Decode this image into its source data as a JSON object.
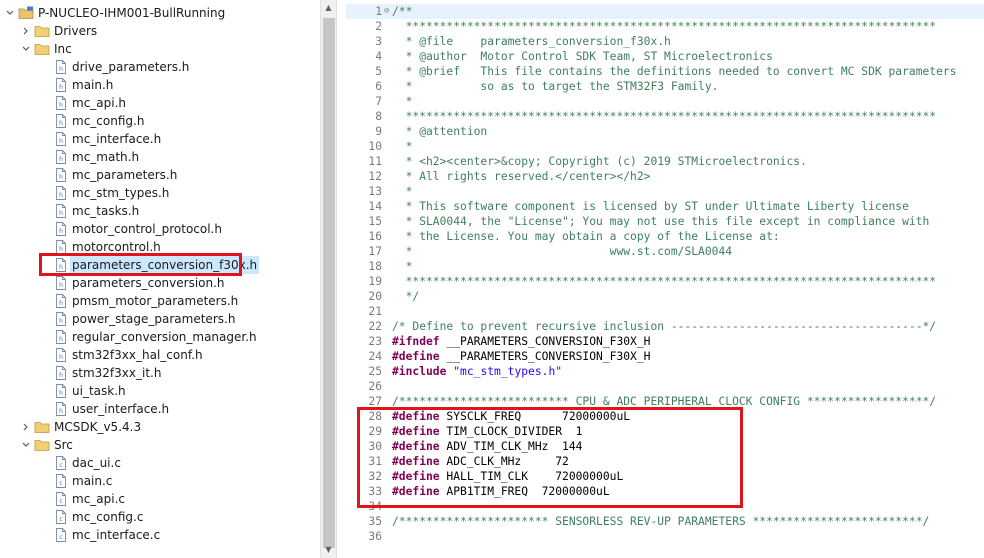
{
  "explorer": {
    "project": "P-NUCLEO-IHM001-BullRunning",
    "items": [
      {
        "label": "Drivers",
        "type": "folder",
        "expanded": false,
        "level": 1
      },
      {
        "label": "Inc",
        "type": "folder",
        "expanded": true,
        "level": 1
      },
      {
        "label": "drive_parameters.h",
        "type": "file",
        "level": 2
      },
      {
        "label": "main.h",
        "type": "file",
        "level": 2
      },
      {
        "label": "mc_api.h",
        "type": "file",
        "level": 2
      },
      {
        "label": "mc_config.h",
        "type": "file",
        "level": 2
      },
      {
        "label": "mc_interface.h",
        "type": "file",
        "level": 2
      },
      {
        "label": "mc_math.h",
        "type": "file",
        "level": 2
      },
      {
        "label": "mc_parameters.h",
        "type": "file",
        "level": 2
      },
      {
        "label": "mc_stm_types.h",
        "type": "file",
        "level": 2
      },
      {
        "label": "mc_tasks.h",
        "type": "file",
        "level": 2
      },
      {
        "label": "motor_control_protocol.h",
        "type": "file",
        "level": 2
      },
      {
        "label": "motorcontrol.h",
        "type": "file",
        "level": 2
      },
      {
        "label": "parameters_conversion_f30x.h",
        "type": "file",
        "level": 2,
        "selected": true
      },
      {
        "label": "parameters_conversion.h",
        "type": "file",
        "level": 2
      },
      {
        "label": "pmsm_motor_parameters.h",
        "type": "file",
        "level": 2
      },
      {
        "label": "power_stage_parameters.h",
        "type": "file",
        "level": 2
      },
      {
        "label": "regular_conversion_manager.h",
        "type": "file",
        "level": 2
      },
      {
        "label": "stm32f3xx_hal_conf.h",
        "type": "file",
        "level": 2
      },
      {
        "label": "stm32f3xx_it.h",
        "type": "file",
        "level": 2
      },
      {
        "label": "ui_task.h",
        "type": "file",
        "level": 2
      },
      {
        "label": "user_interface.h",
        "type": "file",
        "level": 2
      },
      {
        "label": "MCSDK_v5.4.3",
        "type": "folder",
        "expanded": false,
        "level": 1
      },
      {
        "label": "Src",
        "type": "folder",
        "expanded": true,
        "level": 1
      },
      {
        "label": "dac_ui.c",
        "type": "file",
        "level": 2
      },
      {
        "label": "main.c",
        "type": "file",
        "level": 2
      },
      {
        "label": "mc_api.c",
        "type": "file",
        "level": 2
      },
      {
        "label": "mc_config.c",
        "type": "file",
        "level": 2
      },
      {
        "label": "mc_interface.c",
        "type": "file",
        "level": 2
      }
    ]
  },
  "editor": {
    "lines": [
      {
        "n": "1",
        "segs": [
          {
            "t": "/**",
            "c": "comment"
          }
        ],
        "fold": true,
        "current": true
      },
      {
        "n": "2",
        "segs": [
          {
            "t": "  ******************************************************************************",
            "c": "comment"
          }
        ]
      },
      {
        "n": "3",
        "segs": [
          {
            "t": "  * @file    parameters_conversion_f30x.h",
            "c": "comment"
          }
        ]
      },
      {
        "n": "4",
        "segs": [
          {
            "t": "  * @author  Motor Control SDK Team, ST Microelectronics",
            "c": "comment"
          }
        ]
      },
      {
        "n": "5",
        "segs": [
          {
            "t": "  * @brief   This file contains the definitions needed to convert MC SDK parameters",
            "c": "comment"
          }
        ]
      },
      {
        "n": "6",
        "segs": [
          {
            "t": "  *          so as to target the STM32F3 Family.",
            "c": "comment"
          }
        ]
      },
      {
        "n": "7",
        "segs": [
          {
            "t": "  *",
            "c": "comment"
          }
        ]
      },
      {
        "n": "8",
        "segs": [
          {
            "t": "  ******************************************************************************",
            "c": "comment"
          }
        ]
      },
      {
        "n": "9",
        "segs": [
          {
            "t": "  * @attention",
            "c": "comment"
          }
        ]
      },
      {
        "n": "10",
        "segs": [
          {
            "t": "  *",
            "c": "comment"
          }
        ]
      },
      {
        "n": "11",
        "segs": [
          {
            "t": "  * <h2><center>&copy; Copyright (c) 2019 STMicroelectronics.",
            "c": "comment"
          }
        ]
      },
      {
        "n": "12",
        "segs": [
          {
            "t": "  * All rights reserved.</center></h2>",
            "c": "comment"
          }
        ]
      },
      {
        "n": "13",
        "segs": [
          {
            "t": "  *",
            "c": "comment"
          }
        ]
      },
      {
        "n": "14",
        "segs": [
          {
            "t": "  * This software component is licensed by ST under Ultimate Liberty license",
            "c": "comment"
          }
        ]
      },
      {
        "n": "15",
        "segs": [
          {
            "t": "  * SLA0044, the \"License\"; You may not use this file except in compliance with",
            "c": "comment"
          }
        ]
      },
      {
        "n": "16",
        "segs": [
          {
            "t": "  * the License. You may obtain a copy of the License at:",
            "c": "comment"
          }
        ]
      },
      {
        "n": "17",
        "segs": [
          {
            "t": "  *                             www.st.com/SLA0044",
            "c": "comment"
          }
        ]
      },
      {
        "n": "18",
        "segs": [
          {
            "t": "  *",
            "c": "comment"
          }
        ]
      },
      {
        "n": "19",
        "segs": [
          {
            "t": "  ******************************************************************************",
            "c": "comment"
          }
        ]
      },
      {
        "n": "20",
        "segs": [
          {
            "t": "  */",
            "c": "comment"
          }
        ]
      },
      {
        "n": "21",
        "segs": []
      },
      {
        "n": "22",
        "segs": [
          {
            "t": "/* Define to prevent recursive inclusion -------------------------------------*/",
            "c": "comment"
          }
        ]
      },
      {
        "n": "23",
        "segs": [
          {
            "t": "#ifndef",
            "c": "kw"
          },
          {
            "t": " __PARAMETERS_CONVERSION_F30X_H",
            "c": "plain"
          }
        ]
      },
      {
        "n": "24",
        "segs": [
          {
            "t": "#define",
            "c": "kw"
          },
          {
            "t": " __PARAMETERS_CONVERSION_F30X_H",
            "c": "plain"
          }
        ]
      },
      {
        "n": "25",
        "segs": [
          {
            "t": "#include",
            "c": "kw"
          },
          {
            "t": " ",
            "c": "plain"
          },
          {
            "t": "\"mc_stm_types.h\"",
            "c": "str"
          }
        ]
      },
      {
        "n": "26",
        "segs": []
      },
      {
        "n": "27",
        "segs": [
          {
            "t": "/************************* CPU & ADC PERIPHERAL CLOCK CONFIG ******************/",
            "c": "comment"
          }
        ]
      },
      {
        "n": "28",
        "segs": [
          {
            "t": "#define",
            "c": "kw"
          },
          {
            "t": " SYSCLK_FREQ      72000000uL",
            "c": "plain"
          }
        ]
      },
      {
        "n": "29",
        "segs": [
          {
            "t": "#define",
            "c": "kw"
          },
          {
            "t": " TIM_CLOCK_DIVIDER  1",
            "c": "plain"
          }
        ]
      },
      {
        "n": "30",
        "segs": [
          {
            "t": "#define",
            "c": "kw"
          },
          {
            "t": " ADV_TIM_CLK_MHz  144",
            "c": "plain"
          }
        ]
      },
      {
        "n": "31",
        "segs": [
          {
            "t": "#define",
            "c": "kw"
          },
          {
            "t": " ADC_CLK_MHz     72",
            "c": "plain"
          }
        ]
      },
      {
        "n": "32",
        "segs": [
          {
            "t": "#define",
            "c": "kw"
          },
          {
            "t": " HALL_TIM_CLK    72000000uL",
            "c": "plain"
          }
        ]
      },
      {
        "n": "33",
        "segs": [
          {
            "t": "#define",
            "c": "kw"
          },
          {
            "t": " APB1TIM_FREQ  72000000uL",
            "c": "plain"
          }
        ]
      },
      {
        "n": "34",
        "segs": []
      },
      {
        "n": "35",
        "segs": [
          {
            "t": "/********************** SENSORLESS REV-UP PARAMETERS *************************/",
            "c": "comment"
          }
        ]
      },
      {
        "n": "36",
        "segs": []
      }
    ]
  },
  "colors": {
    "annotation": "#e0141d",
    "comment": "#3f7f5f",
    "keyword": "#7f0055",
    "string": "#2a00ff",
    "selection": "#cce8ff"
  },
  "icons": {
    "folder": "folder-icon",
    "file": "header-file-icon",
    "collapsed": "chevron-right-icon",
    "expanded": "chevron-down-icon"
  }
}
